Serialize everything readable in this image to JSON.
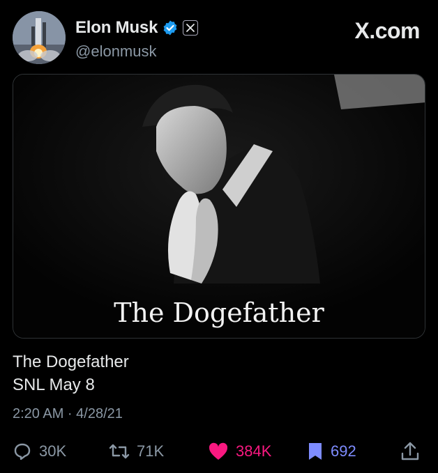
{
  "header": {
    "display_name": "Elon Musk",
    "handle": "@elonmusk",
    "brand": "X.com",
    "verified_icon": "verified-badge-icon",
    "affiliation_icon": "x-logo-icon",
    "colors": {
      "verified": "#1d9bf0"
    }
  },
  "media": {
    "caption": "The Dogefather"
  },
  "tweet": {
    "lines": [
      "The Dogefather",
      "SNL May 8"
    ],
    "timestamp": "2:20 AM · 4/28/21"
  },
  "actions": {
    "reply": {
      "count": "30K",
      "icon": "reply-icon"
    },
    "retweet": {
      "count": "71K",
      "icon": "retweet-icon"
    },
    "like": {
      "count": "384K",
      "icon": "heart-icon",
      "color": "#f91880"
    },
    "bookmark": {
      "count": "692",
      "icon": "bookmark-icon",
      "color": "#7e8cff"
    },
    "share": {
      "icon": "share-icon"
    }
  }
}
